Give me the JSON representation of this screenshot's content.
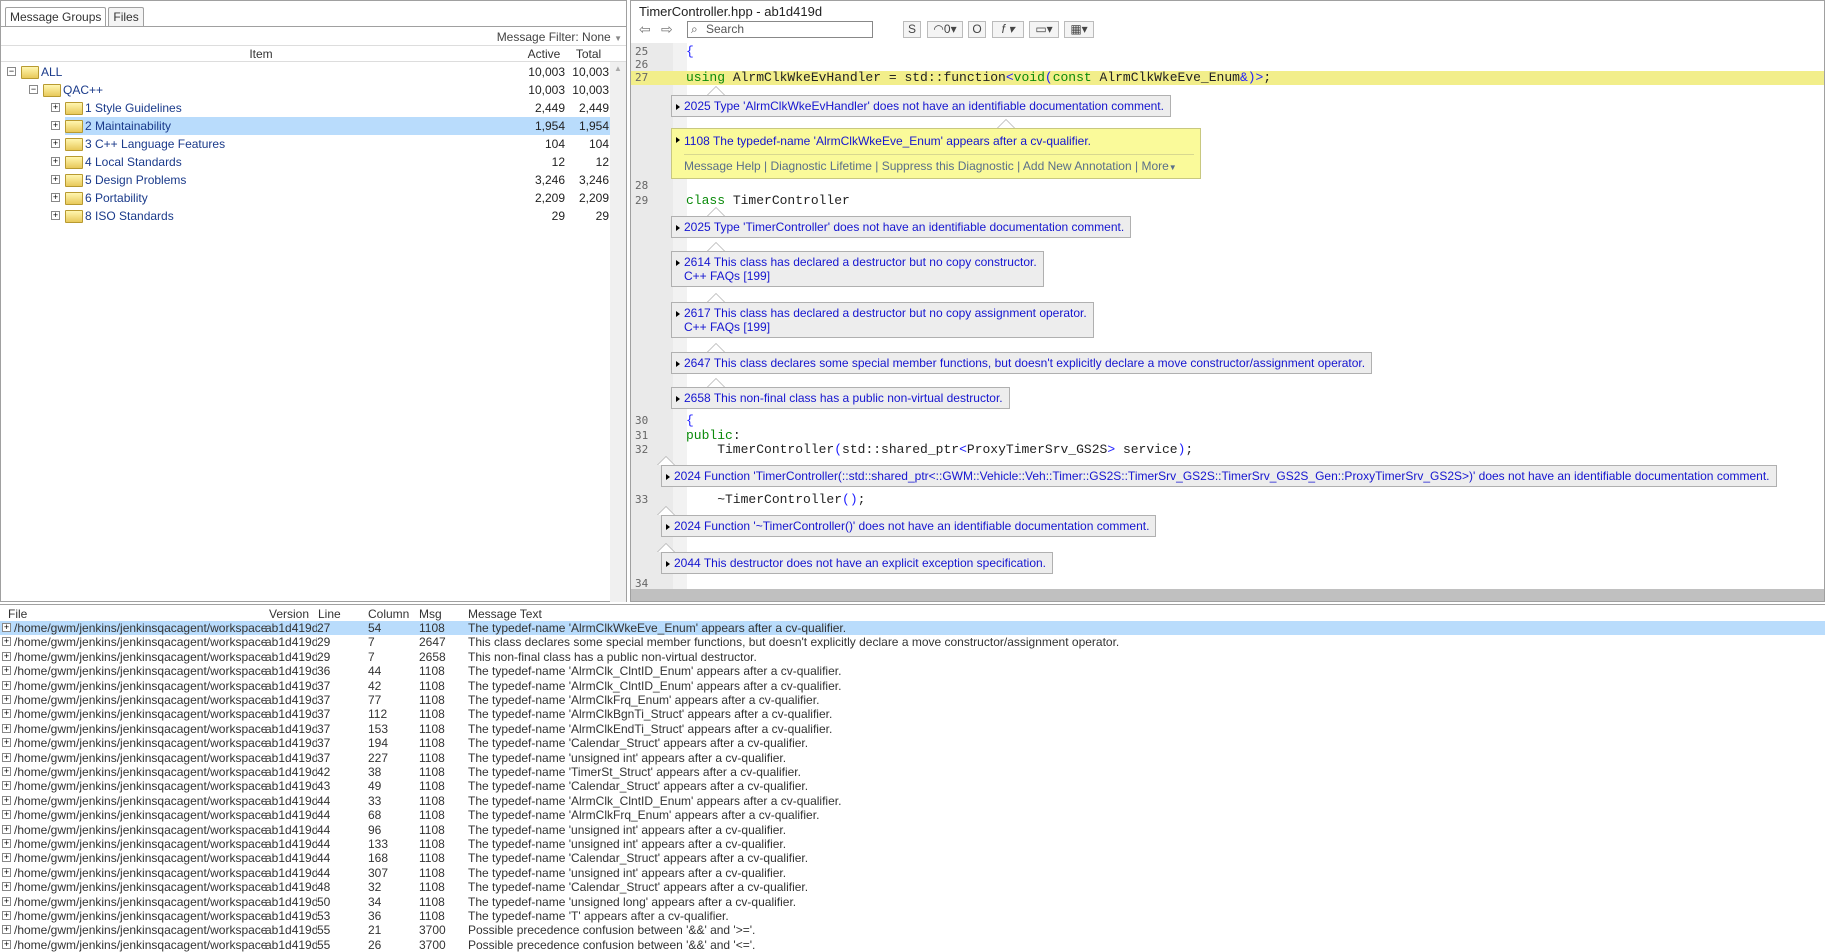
{
  "left_panel": {
    "tabs": [
      {
        "label": "Message Groups",
        "active": true
      },
      {
        "label": "Files",
        "active": false
      }
    ],
    "filter": "Message Filter: None",
    "columns": {
      "item": "Item",
      "active": "Active",
      "total": "Total"
    },
    "tree": [
      {
        "label": "ALL",
        "active": "10,003",
        "total": "10,003",
        "level": 0,
        "expanded": true,
        "selected": false
      },
      {
        "label": "QAC++",
        "active": "10,003",
        "total": "10,003",
        "level": 1,
        "expanded": true,
        "selected": false
      },
      {
        "label": "1 Style Guidelines",
        "active": "2,449",
        "total": "2,449",
        "level": 2,
        "expanded": false,
        "selected": false
      },
      {
        "label": "2 Maintainability",
        "active": "1,954",
        "total": "1,954",
        "level": 2,
        "expanded": false,
        "selected": true
      },
      {
        "label": "3 C++ Language Features",
        "active": "104",
        "total": "104",
        "level": 2,
        "expanded": false,
        "selected": false
      },
      {
        "label": "4 Local Standards",
        "active": "12",
        "total": "12",
        "level": 2,
        "expanded": false,
        "selected": false
      },
      {
        "label": "5 Design Problems",
        "active": "3,246",
        "total": "3,246",
        "level": 2,
        "expanded": false,
        "selected": false
      },
      {
        "label": "6 Portability",
        "active": "2,209",
        "total": "2,209",
        "level": 2,
        "expanded": false,
        "selected": false
      },
      {
        "label": "8 ISO Standards",
        "active": "29",
        "total": "29",
        "level": 2,
        "expanded": false,
        "selected": false
      }
    ]
  },
  "code_panel": {
    "title": "TimerController.hpp - ab1d419d",
    "search_placeholder": "Search",
    "toolbar": {
      "s": "S",
      "count": "0",
      "o": "O",
      "f": "f"
    },
    "lines": [
      {
        "n": "25",
        "tokens": [
          [
            "br",
            "{"
          ]
        ]
      },
      {
        "n": "26",
        "tokens": []
      },
      {
        "n": "27",
        "highlight": true,
        "tokens": [
          [
            "kw",
            "using "
          ],
          [
            "id",
            "AlrmClkWkeEvHandler = std::function"
          ],
          [
            "br",
            "<"
          ],
          [
            "kw",
            "void"
          ],
          [
            "br",
            "("
          ],
          [
            "kw",
            "const "
          ],
          [
            "id",
            "AlrmClkWkeEve_Enum"
          ],
          [
            "br",
            "&)>"
          ],
          [
            "id",
            ";"
          ]
        ]
      },
      {
        "n": "28",
        "tokens": []
      },
      {
        "n": "29",
        "tokens": [
          [
            "kw",
            "class "
          ],
          [
            "id",
            "TimerController"
          ]
        ]
      },
      {
        "n": "30",
        "tokens": [
          [
            "br",
            "{"
          ]
        ]
      },
      {
        "n": "31",
        "tokens": [
          [
            "kw",
            "public"
          ],
          [
            "id",
            ":"
          ]
        ]
      },
      {
        "n": "32",
        "tokens": [
          [
            "id",
            "    TimerController"
          ],
          [
            "br",
            "("
          ],
          [
            "id",
            "std::shared_ptr"
          ],
          [
            "br",
            "<"
          ],
          [
            "id",
            "ProxyTimerSrv_GS2S"
          ],
          [
            "br",
            ">"
          ],
          [
            "id",
            " service"
          ],
          [
            "br",
            ")"
          ],
          [
            "id",
            ";"
          ]
        ]
      },
      {
        "n": "33",
        "tokens": [
          [
            "id",
            "    ~TimerController"
          ],
          [
            "br",
            "()"
          ],
          [
            "id",
            ";"
          ]
        ]
      },
      {
        "n": "34",
        "tokens": []
      }
    ],
    "diagnostics": [
      {
        "id": "2025",
        "text": "Type 'AlrmClkWkeEvHandler' does not have an identifiable documentation comment."
      },
      {
        "id": "1108",
        "text": "The typedef-name 'AlrmClkWkeEve_Enum' appears after a cv-qualifier.",
        "active": true,
        "actions": [
          "Message Help",
          "Diagnostic Lifetime",
          "Suppress this Diagnostic",
          "Add New Annotation",
          "More"
        ]
      },
      {
        "id": "2025",
        "text": "Type 'TimerController' does not have an identifiable documentation comment."
      },
      {
        "id": "2614",
        "text": "This class has declared a destructor but no copy constructor.",
        "ref": "C++ FAQs [199]"
      },
      {
        "id": "2617",
        "text": "This class has declared a destructor but no copy assignment operator.",
        "ref": "C++ FAQs [199]"
      },
      {
        "id": "2647",
        "text": "This class declares some special member functions, but doesn't explicitly declare a move constructor/assignment operator."
      },
      {
        "id": "2658",
        "text": "This non-final class has a public non-virtual destructor."
      },
      {
        "id": "2024",
        "text": "Function 'TimerController(::std::shared_ptr<::GWM::Vehicle::Veh::Timer::GS2S::TimerSrv_GS2S::TimerSrv_GS2S_Gen::ProxyTimerSrv_GS2S>)' does not have an identifiable documentation comment."
      },
      {
        "id": "2024",
        "text": "Function '~TimerController()' does not have an identifiable documentation comment."
      },
      {
        "id": "2044",
        "text": "This destructor does not have an explicit exception specification."
      }
    ]
  },
  "messages": {
    "columns": {
      "file": "File",
      "version": "Version",
      "line": "Line",
      "column": "Column",
      "msg": "Msg",
      "text": "Message Text"
    },
    "rows": [
      {
        "file": "/home/gwm/jenkins/jenkinsqacagent/workspace",
        "version": "ab1d419d",
        "line": "27",
        "column": "54",
        "msg": "1108",
        "text": "The typedef-name 'AlrmClkWkeEve_Enum' appears after a cv-qualifier.",
        "selected": true
      },
      {
        "file": "/home/gwm/jenkins/jenkinsqacagent/workspace",
        "version": "ab1d419d",
        "line": "29",
        "column": "7",
        "msg": "2647",
        "text": "This class declares some special member functions, but doesn't explicitly declare a move constructor/assignment operator."
      },
      {
        "file": "/home/gwm/jenkins/jenkinsqacagent/workspace",
        "version": "ab1d419d",
        "line": "29",
        "column": "7",
        "msg": "2658",
        "text": "This non-final class has a public non-virtual destructor."
      },
      {
        "file": "/home/gwm/jenkins/jenkinsqacagent/workspace",
        "version": "ab1d419d",
        "line": "36",
        "column": "44",
        "msg": "1108",
        "text": "The typedef-name 'AlrmClk_ClntID_Enum' appears after a cv-qualifier."
      },
      {
        "file": "/home/gwm/jenkins/jenkinsqacagent/workspace",
        "version": "ab1d419d",
        "line": "37",
        "column": "42",
        "msg": "1108",
        "text": "The typedef-name 'AlrmClk_ClntID_Enum' appears after a cv-qualifier."
      },
      {
        "file": "/home/gwm/jenkins/jenkinsqacagent/workspace",
        "version": "ab1d419d",
        "line": "37",
        "column": "77",
        "msg": "1108",
        "text": "The typedef-name 'AlrmClkFrq_Enum' appears after a cv-qualifier."
      },
      {
        "file": "/home/gwm/jenkins/jenkinsqacagent/workspace",
        "version": "ab1d419d",
        "line": "37",
        "column": "112",
        "msg": "1108",
        "text": "The typedef-name 'AlrmClkBgnTi_Struct' appears after a cv-qualifier."
      },
      {
        "file": "/home/gwm/jenkins/jenkinsqacagent/workspace",
        "version": "ab1d419d",
        "line": "37",
        "column": "153",
        "msg": "1108",
        "text": "The typedef-name 'AlrmClkEndTi_Struct' appears after a cv-qualifier."
      },
      {
        "file": "/home/gwm/jenkins/jenkinsqacagent/workspace",
        "version": "ab1d419d",
        "line": "37",
        "column": "194",
        "msg": "1108",
        "text": "The typedef-name 'Calendar_Struct' appears after a cv-qualifier."
      },
      {
        "file": "/home/gwm/jenkins/jenkinsqacagent/workspace",
        "version": "ab1d419d",
        "line": "37",
        "column": "227",
        "msg": "1108",
        "text": "The typedef-name 'unsigned int' appears after a cv-qualifier."
      },
      {
        "file": "/home/gwm/jenkins/jenkinsqacagent/workspace",
        "version": "ab1d419d",
        "line": "42",
        "column": "38",
        "msg": "1108",
        "text": "The typedef-name 'TimerSt_Struct' appears after a cv-qualifier."
      },
      {
        "file": "/home/gwm/jenkins/jenkinsqacagent/workspace",
        "version": "ab1d419d",
        "line": "43",
        "column": "49",
        "msg": "1108",
        "text": "The typedef-name 'Calendar_Struct' appears after a cv-qualifier."
      },
      {
        "file": "/home/gwm/jenkins/jenkinsqacagent/workspace",
        "version": "ab1d419d",
        "line": "44",
        "column": "33",
        "msg": "1108",
        "text": "The typedef-name 'AlrmClk_ClntID_Enum' appears after a cv-qualifier."
      },
      {
        "file": "/home/gwm/jenkins/jenkinsqacagent/workspace",
        "version": "ab1d419d",
        "line": "44",
        "column": "68",
        "msg": "1108",
        "text": "The typedef-name 'AlrmClkFrq_Enum' appears after a cv-qualifier."
      },
      {
        "file": "/home/gwm/jenkins/jenkinsqacagent/workspace",
        "version": "ab1d419d",
        "line": "44",
        "column": "96",
        "msg": "1108",
        "text": "The typedef-name 'unsigned int' appears after a cv-qualifier."
      },
      {
        "file": "/home/gwm/jenkins/jenkinsqacagent/workspace",
        "version": "ab1d419d",
        "line": "44",
        "column": "133",
        "msg": "1108",
        "text": "The typedef-name 'unsigned int' appears after a cv-qualifier."
      },
      {
        "file": "/home/gwm/jenkins/jenkinsqacagent/workspace",
        "version": "ab1d419d",
        "line": "44",
        "column": "168",
        "msg": "1108",
        "text": "The typedef-name 'Calendar_Struct' appears after a cv-qualifier."
      },
      {
        "file": "/home/gwm/jenkins/jenkinsqacagent/workspace",
        "version": "ab1d419d",
        "line": "44",
        "column": "307",
        "msg": "1108",
        "text": "The typedef-name 'unsigned int' appears after a cv-qualifier."
      },
      {
        "file": "/home/gwm/jenkins/jenkinsqacagent/workspace",
        "version": "ab1d419d",
        "line": "48",
        "column": "32",
        "msg": "1108",
        "text": "The typedef-name 'Calendar_Struct' appears after a cv-qualifier."
      },
      {
        "file": "/home/gwm/jenkins/jenkinsqacagent/workspace",
        "version": "ab1d419d",
        "line": "50",
        "column": "34",
        "msg": "1108",
        "text": "The typedef-name 'unsigned long' appears after a cv-qualifier."
      },
      {
        "file": "/home/gwm/jenkins/jenkinsqacagent/workspace",
        "version": "ab1d419d",
        "line": "53",
        "column": "36",
        "msg": "1108",
        "text": "The typedef-name 'T' appears after a cv-qualifier."
      },
      {
        "file": "/home/gwm/jenkins/jenkinsqacagent/workspace",
        "version": "ab1d419d",
        "line": "55",
        "column": "21",
        "msg": "3700",
        "text": "Possible precedence confusion between '&&' and '>='."
      },
      {
        "file": "/home/gwm/jenkins/jenkinsqacagent/workspace",
        "version": "ab1d419d",
        "line": "55",
        "column": "26",
        "msg": "3700",
        "text": "Possible precedence confusion between '&&' and '<='."
      }
    ]
  },
  "colors": {
    "selection": "#b9dcfc",
    "highlight_line": "#f2ee8a",
    "diagnostic_text": "#1515d0",
    "keyword": "#0a8a0a",
    "active_bubble": "#fafa9a"
  }
}
